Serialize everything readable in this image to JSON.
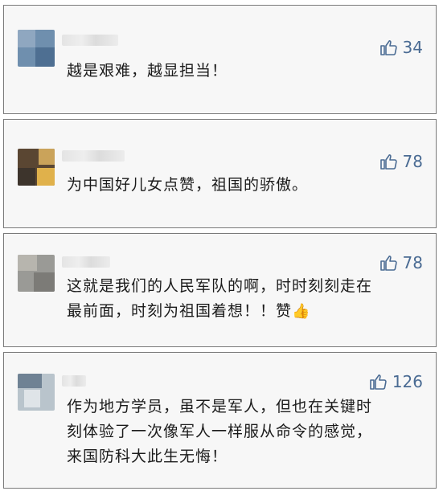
{
  "comments": [
    {
      "likes": "34",
      "lines": [
        "越是艰难，越显担当！"
      ]
    },
    {
      "likes": "78",
      "lines": [
        "为中国好儿女点赞，祖国的骄傲。"
      ]
    },
    {
      "likes": "78",
      "lines": [
        "这就是我们的人民军队的啊，时时刻刻走在",
        "最前面，时刻为祖国着想！！赞"
      ],
      "emoji": "👍"
    },
    {
      "likes": "126",
      "lines": [
        "作为地方学员，虽不是军人，但也在关键时",
        "刻体验了一次像军人一样服从命令的感觉，",
        "来国防科大此生无悔！"
      ]
    }
  ],
  "icons": {
    "like": "thumbs-up-outline-icon"
  },
  "colors": {
    "like_count": "#4a6b93",
    "card_bg": "#f7f7f7",
    "card_border": "#7a7a7a"
  }
}
